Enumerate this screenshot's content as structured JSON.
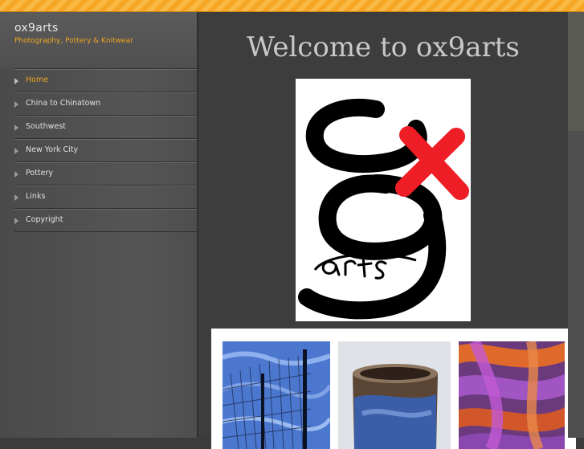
{
  "site": {
    "title": "ox9arts",
    "subtitle": "Photography, Pottery & Knitwear"
  },
  "nav": {
    "items": [
      {
        "label": "Home",
        "active": true
      },
      {
        "label": "China to Chinatown",
        "active": false
      },
      {
        "label": "Southwest",
        "active": false
      },
      {
        "label": "New York City",
        "active": false
      },
      {
        "label": "Pottery",
        "active": false
      },
      {
        "label": "Links",
        "active": false
      },
      {
        "label": "Copyright",
        "active": false
      }
    ]
  },
  "main": {
    "heading": "Welcome to ox9arts",
    "logo_icon": "ox9arts-logo",
    "gallery": [
      {
        "icon": "fence-reflection-photo"
      },
      {
        "icon": "pottery-cup-photo"
      },
      {
        "icon": "knitwear-scarves-photo"
      }
    ]
  },
  "colors": {
    "accent": "#f0a51e",
    "sidebar": "#4f4f4f",
    "content": "#3d3d3d",
    "heading": "#c8c8c8"
  }
}
